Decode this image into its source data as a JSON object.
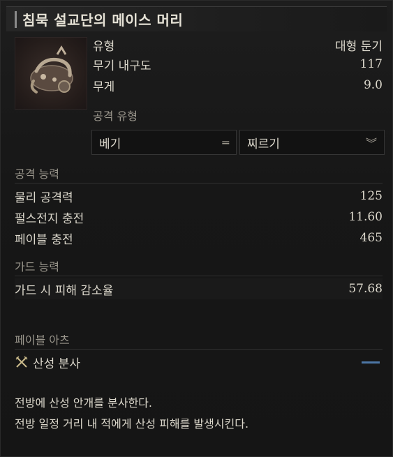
{
  "item": {
    "name": "침묵 설교단의 메이스 머리",
    "type_label": "유형",
    "type_value": "대형 둔기",
    "durability_label": "무기 내구도",
    "durability_value": "117",
    "weight_label": "무게",
    "weight_value": "9.0"
  },
  "attack_type": {
    "label": "공격 유형",
    "option1": "베기",
    "option2": "찌르기"
  },
  "attack_ability": {
    "header": "공격 능력",
    "rows": [
      {
        "label": "물리 공격력",
        "value": "125"
      },
      {
        "label": "펄스전지 충전",
        "value": "11.60"
      },
      {
        "label": "페이블 충전",
        "value": "465"
      }
    ]
  },
  "guard_ability": {
    "header": "가드 능력",
    "rows": [
      {
        "label": "가드 시 피해 감소율",
        "value": "57.68"
      }
    ]
  },
  "fable_arts": {
    "header": "페이블 아츠",
    "skill_name": "산성 분사",
    "skill_icon": "crossed-swords-icon",
    "accent_color": "#4d77a6"
  },
  "description": {
    "line1": "전방에 산성 안개를 분사한다.",
    "line2": "전방 일정 거리 내 적에게 산성 피해를 발생시킨다."
  }
}
